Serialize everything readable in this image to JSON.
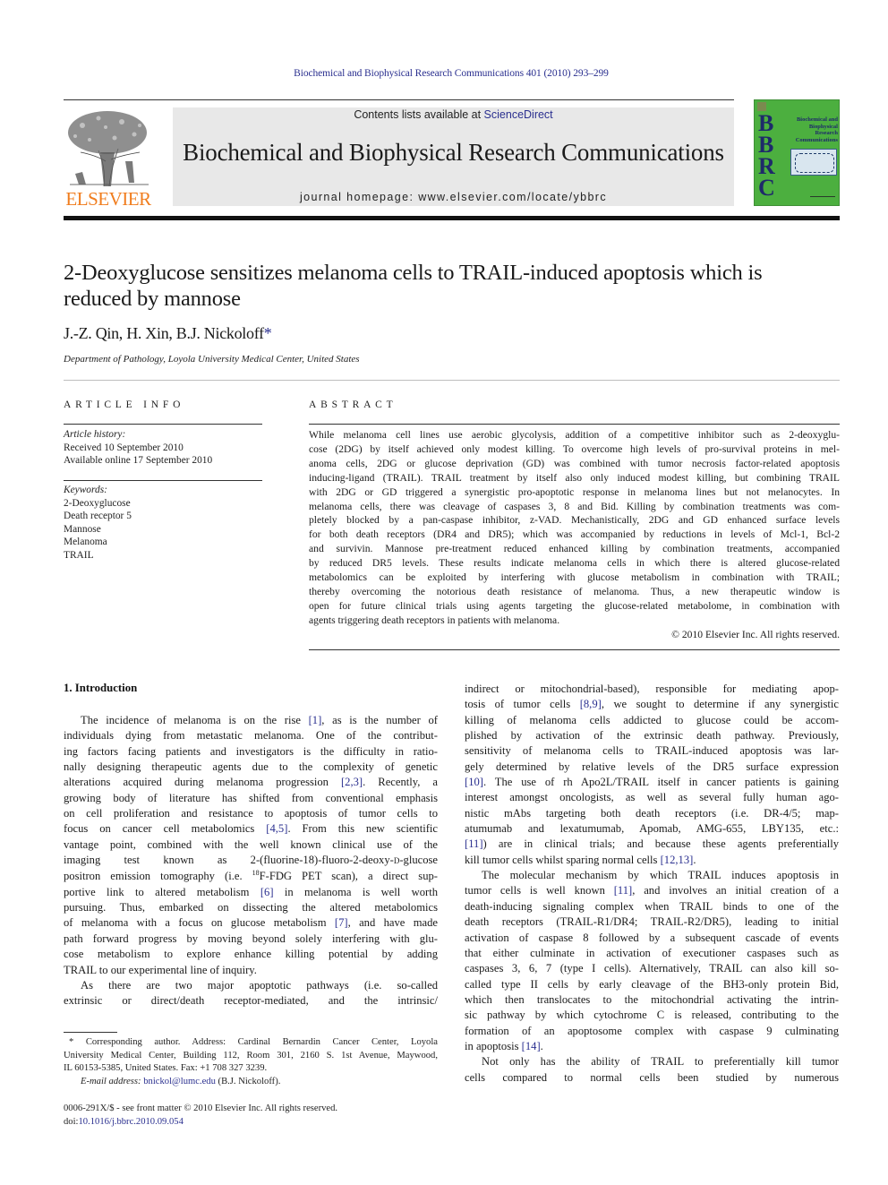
{
  "header": {
    "citation": "Biochemical and Biophysical Research Communications 401 (2010) 293–299",
    "contents_prefix": "Contents lists available at ",
    "contents_link": "ScienceDirect",
    "journal_title": "Biochemical and Biophysical Research Communications",
    "homepage": "journal homepage: www.elsevier.com/locate/ybbrc",
    "publisher_logo_text": "ELSEVIER",
    "cover": {
      "letters": [
        "B",
        "B",
        "R",
        "C"
      ],
      "title_lines": [
        "Biochemical and",
        "Biophysical",
        "Research",
        "Communications"
      ]
    },
    "colors": {
      "publisher_orange": "#f07d1e",
      "link_blue": "#2a2f8f",
      "cover_green": "#4caf3f"
    }
  },
  "article": {
    "title_lines": [
      "2-Deoxyglucose sensitizes melanoma cells to TRAIL-induced apoptosis which is",
      "reduced by mannose"
    ],
    "authors": "J.-Z. Qin, H. Xin, B.J. Nickoloff",
    "author_mark": "*",
    "affiliation": "Department of Pathology, Loyola University Medical Center, United States"
  },
  "article_info": {
    "heading": "ARTICLE INFO",
    "history_label": "Article history:",
    "history": [
      "Received 10 September 2010",
      "Available online 17 September 2010"
    ],
    "keywords_label": "Keywords:",
    "keywords": [
      "2-Deoxyglucose",
      "Death receptor 5",
      "Mannose",
      "Melanoma",
      "TRAIL"
    ]
  },
  "abstract": {
    "heading": "ABSTRACT",
    "lines": [
      "While melanoma cell lines use aerobic glycolysis, addition of a competitive inhibitor such as 2-deoxyglu-",
      "cose (2DG) by itself achieved only modest killing. To overcome high levels of pro-survival proteins in mel-",
      "anoma cells, 2DG or glucose deprivation (GD) was combined with tumor necrosis factor-related apoptosis",
      "inducing-ligand (TRAIL). TRAIL treatment by itself also only induced modest killing, but combining TRAIL",
      "with 2DG or GD triggered a synergistic pro-apoptotic response in melanoma lines but not melanocytes. In",
      "melanoma cells, there was cleavage of caspases 3, 8 and Bid. Killing by combination treatments was com-",
      "pletely blocked by a pan-caspase inhibitor, z-VAD. Mechanistically, 2DG and GD enhanced surface levels",
      "for both death receptors (DR4 and DR5); which was accompanied by reductions in levels of Mcl-1, Bcl-2",
      "and survivin. Mannose pre-treatment reduced enhanced killing by combination treatments, accompanied",
      "by reduced DR5 levels. These results indicate melanoma cells in which there is altered glucose-related",
      "metabolomics can be exploited by interfering with glucose metabolism in combination with TRAIL;",
      "thereby overcoming the notorious death resistance of melanoma. Thus, a new therapeutic window is",
      "open for future clinical trials using agents targeting the glucose-related metabolome, in combination with",
      "agents triggering death receptors in patients with melanoma."
    ],
    "copyright": "© 2010 Elsevier Inc. All rights reserved."
  },
  "introduction": {
    "heading": "1. Introduction",
    "left_column": [
      {
        "t": "The incidence of melanoma is on the rise ",
        "r": "[1]",
        "a": ", as is the number of",
        "indent": true
      },
      {
        "t": "individuals dying from metastatic melanoma. One of the contribut-"
      },
      {
        "t": "ing factors facing patients and investigators is the difficulty in ratio-"
      },
      {
        "t": "nally designing therapeutic agents due to the complexity of genetic"
      },
      {
        "t": "alterations acquired during melanoma progression ",
        "r": "[2,3]",
        "a": ". Recently, a"
      },
      {
        "t": "growing body of literature has shifted from conventional emphasis"
      },
      {
        "t": "on cell proliferation and resistance to apoptosis of tumor cells to"
      },
      {
        "t": "focus on cancer cell metabolomics ",
        "r": "[4,5]",
        "a": ". From this new scientific"
      },
      {
        "t": "vantage point, combined with the well known clinical use of the"
      },
      {
        "t": "imaging test known as 2-(fluorine-18)-fluoro-2-deoxy-",
        "sc": "D",
        "a": "-glucose"
      },
      {
        "t": "positron emission tomography (i.e. ",
        "sup": "18",
        "a": "F-FDG PET scan), a direct sup-"
      },
      {
        "t": "portive link to altered metabolism ",
        "r": "[6]",
        "a": " in melanoma is well worth"
      },
      {
        "t": "pursuing. Thus, embarked on dissecting the altered metabolomics"
      },
      {
        "t": "of melanoma with a focus on glucose metabolism ",
        "r": "[7]",
        "a": ", and have made"
      },
      {
        "t": "path forward progress by moving beyond solely interfering with glu-"
      },
      {
        "t": "cose metabolism to explore enhance killing potential by adding"
      },
      {
        "t": "TRAIL to our experimental line of inquiry.",
        "last": true
      },
      {
        "t": "As there are two major apoptotic pathways (i.e. so-called",
        "indent": true
      },
      {
        "t": "extrinsic or direct/death receptor-mediated, and the intrinsic/"
      }
    ],
    "right_column": [
      {
        "t": "indirect or mitochondrial-based), responsible for mediating apop-"
      },
      {
        "t": "tosis of tumor cells ",
        "r": "[8,9]",
        "a": ", we sought to determine if any synergistic"
      },
      {
        "t": "killing of melanoma cells addicted to glucose could be accom-"
      },
      {
        "t": "plished by activation of the extrinsic death pathway. Previously,"
      },
      {
        "t": "sensitivity of melanoma cells to TRAIL-induced apoptosis was lar-"
      },
      {
        "t": "gely determined by relative levels of the DR5 surface expression"
      },
      {
        "t": "",
        "r": "[10]",
        "a": ". The use of rh Apo2L/TRAIL itself in cancer patients is gaining"
      },
      {
        "t": "interest amongst oncologists, as well as several fully human ago-"
      },
      {
        "t": "nistic mAbs targeting both death receptors (i.e. DR-4/5; map-"
      },
      {
        "t": "atumumab and lexatumumab, Apomab, AMG-655, LBY135, etc.:"
      },
      {
        "t": "",
        "r": "[11]",
        "a": ") are in clinical trials; and because these agents preferentially"
      },
      {
        "t": "kill tumor cells whilst sparing normal cells ",
        "r": "[12,13]",
        "a": ".",
        "last": true
      },
      {
        "t": "The molecular mechanism by which TRAIL induces apoptosis in",
        "indent": true
      },
      {
        "t": "tumor cells is well known ",
        "r": "[11]",
        "a": ", and involves an initial creation of a"
      },
      {
        "t": "death-inducing signaling complex when TRAIL binds to one of the"
      },
      {
        "t": "death receptors (TRAIL-R1/DR4; TRAIL-R2/DR5), leading to initial"
      },
      {
        "t": "activation of caspase 8 followed by a subsequent cascade of events"
      },
      {
        "t": "that either culminate in activation of executioner caspases such as"
      },
      {
        "t": "caspases 3, 6, 7 (type I cells). Alternatively, TRAIL can also kill so-"
      },
      {
        "t": "called type II cells by early cleavage of the BH3-only protein Bid,"
      },
      {
        "t": "which then translocates to the mitochondrial activating the intrin-"
      },
      {
        "t": "sic pathway by which cytochrome C is released, contributing to the"
      },
      {
        "t": "formation of an apoptosome complex with caspase 9 culminating"
      },
      {
        "t": "in apoptosis ",
        "r": "[14]",
        "a": ".",
        "last": true
      },
      {
        "t": "Not only has the ability of TRAIL to preferentially kill tumor",
        "indent": true
      },
      {
        "t": "cells compared to normal cells been studied by numerous"
      }
    ]
  },
  "footnotes": {
    "corresponding_lines": [
      "* Corresponding author. Address: Cardinal Bernardin Cancer Center, Loyola",
      "University Medical Center, Building 112, Room 301, 2160 S. 1st Avenue, Maywood,",
      "IL 60153-5385, United States. Fax: +1 708 327 3239."
    ],
    "email_label": "E-mail address:",
    "email": "bnickol@lumc.edu",
    "email_suffix": " (B.J. Nickoloff).",
    "front_matter": "0006-291X/$ - see front matter © 2010 Elsevier Inc. All rights reserved.",
    "doi_prefix": "doi:",
    "doi": "10.1016/j.bbrc.2010.09.054"
  }
}
